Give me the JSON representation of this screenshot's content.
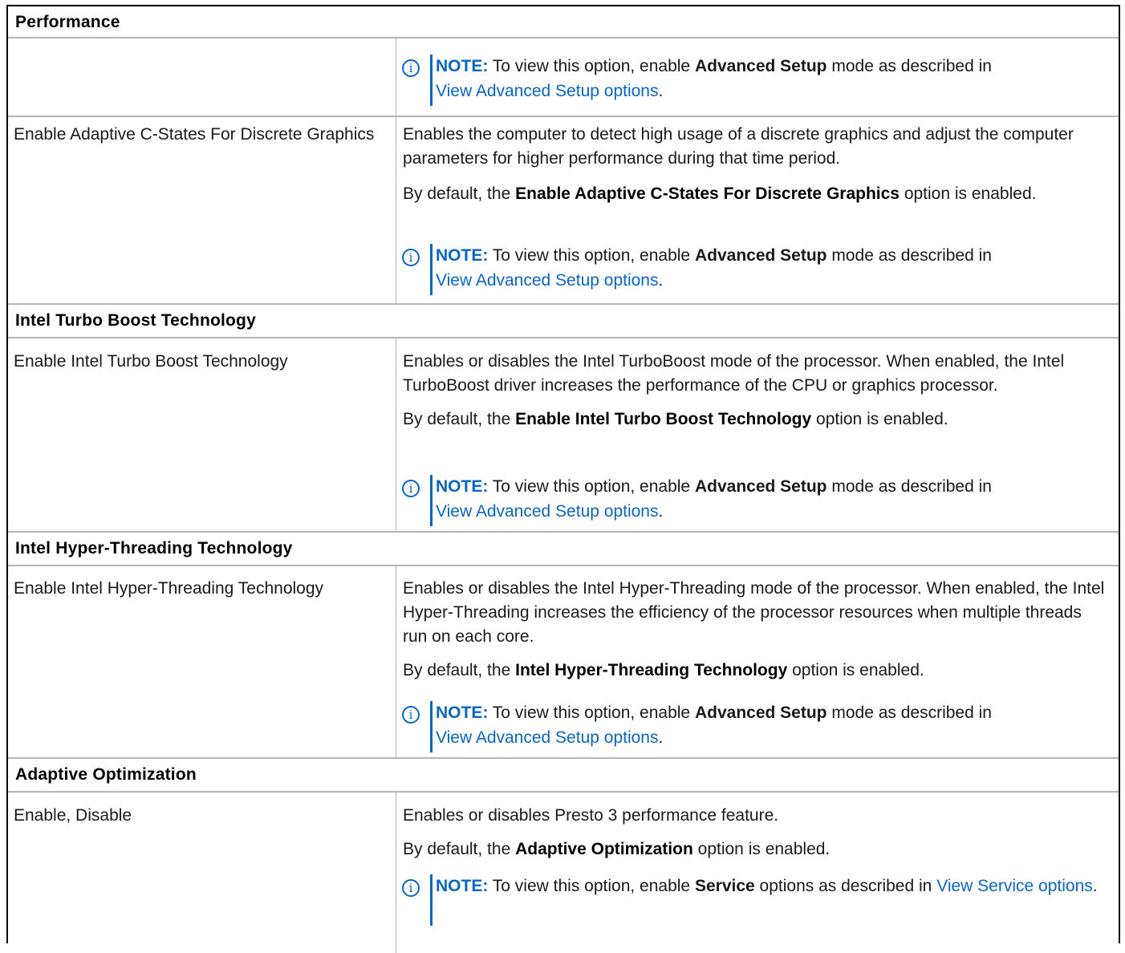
{
  "sections": {
    "performance": "Performance",
    "turbo": "Intel Turbo Boost Technology",
    "hyper": "Intel Hyper-Threading Technology",
    "adaptive": "Adaptive Optimization"
  },
  "note": {
    "label": "NOTE:",
    "pre": "To view this option, enable",
    "advanced_bold": "Advanced Setup",
    "advanced_mid": "mode as described in",
    "advanced_link": "View Advanced Setup options",
    "period": ".",
    "service_bold": "Service",
    "service_mid": "options as described in",
    "service_link": "View Service options"
  },
  "rows": {
    "cstates": {
      "name": "Enable Adaptive C-States For Discrete Graphics",
      "desc": "Enables the computer to detect high usage of a discrete graphics and adjust the computer parameters for higher performance during that time period.",
      "default_pre": "By default, the",
      "default_bold": "Enable Adaptive C-States For Discrete Graphics",
      "default_post": "option is enabled."
    },
    "turbo": {
      "name": "Enable Intel Turbo Boost Technology",
      "desc": "Enables or disables the Intel TurboBoost mode of the processor. When enabled, the Intel TurboBoost driver increases the performance of the CPU or graphics processor.",
      "default_pre": "By default, the",
      "default_bold": "Enable Intel Turbo Boost Technology",
      "default_post": "option is enabled."
    },
    "hyper": {
      "name": "Enable Intel Hyper-Threading Technology",
      "desc": "Enables or disables the Intel Hyper-Threading mode of the processor. When enabled, the Intel Hyper-Threading increases the efficiency of the processor resources when multiple threads run on each core.",
      "default_pre": "By default, the",
      "default_bold": "Intel Hyper-Threading Technology",
      "default_post": "option is enabled."
    },
    "adaptive": {
      "name": "Enable, Disable",
      "desc": "Enables or disables Presto 3 performance feature.",
      "default_pre": "By default, the",
      "default_bold": "Adaptive Optimization",
      "default_post": "option is enabled."
    }
  },
  "colors": {
    "accent": "#0a66c2",
    "border": "#b5b5b5"
  }
}
